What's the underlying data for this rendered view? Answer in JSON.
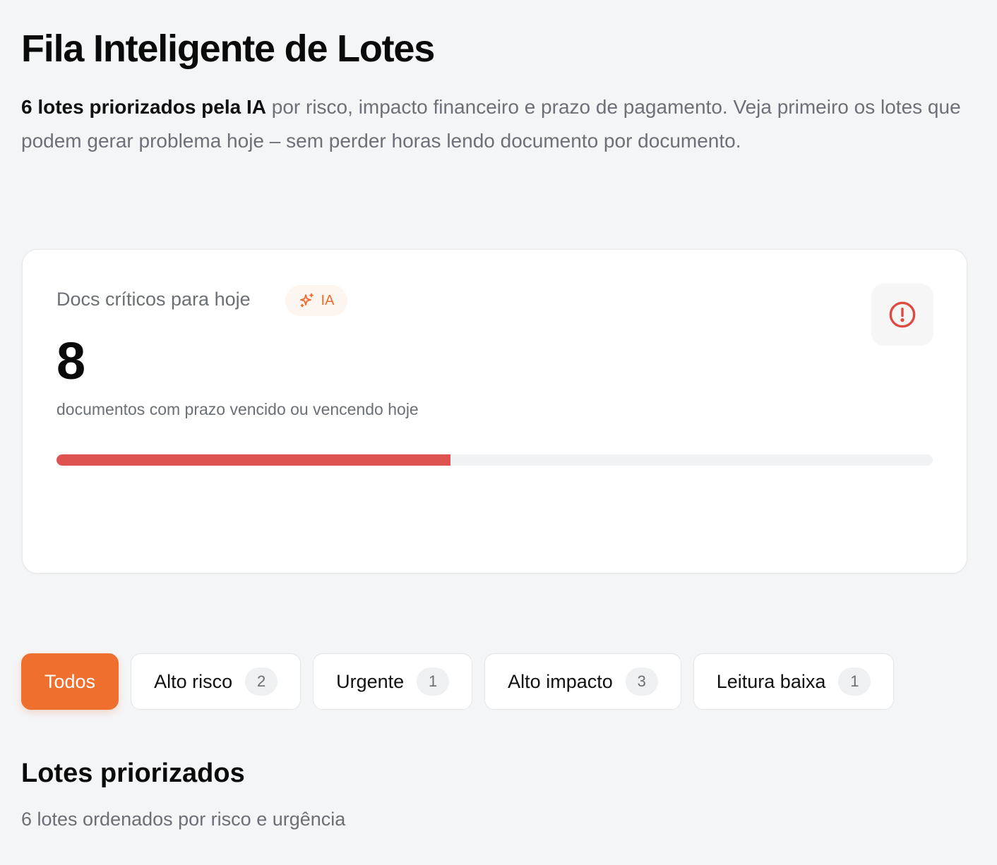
{
  "header": {
    "title": "Fila Inteligente de Lotes",
    "subtitle_strong": "6 lotes priorizados pela IA",
    "subtitle_rest": " por risco, impacto financeiro e prazo de pagamento. Veja primeiro os lotes que podem gerar problema hoje – sem perder horas lendo documento por documento."
  },
  "critical_card": {
    "label": "Docs críticos para hoje",
    "ai_badge": "IA",
    "ai_icon": "sparkles-icon",
    "alert_icon": "alert-circle-icon",
    "value": "8",
    "caption": "documentos com prazo vencido ou vencendo hoje",
    "progress_fraction": 0.45,
    "progress_color": "#de524f"
  },
  "filters": {
    "todos": {
      "label": "Todos"
    },
    "alto_risco": {
      "label": "Alto risco",
      "count": "2"
    },
    "urgente": {
      "label": "Urgente",
      "count": "1"
    },
    "alto_impacto": {
      "label": "Alto impacto",
      "count": "3"
    },
    "leitura_baixa": {
      "label": "Leitura baixa",
      "count": "1"
    }
  },
  "section": {
    "title": "Lotes priorizados",
    "subtitle": "6 lotes ordenados por risco e urgência"
  },
  "colors": {
    "accent": "#ef6f2e",
    "danger": "#de524f"
  }
}
